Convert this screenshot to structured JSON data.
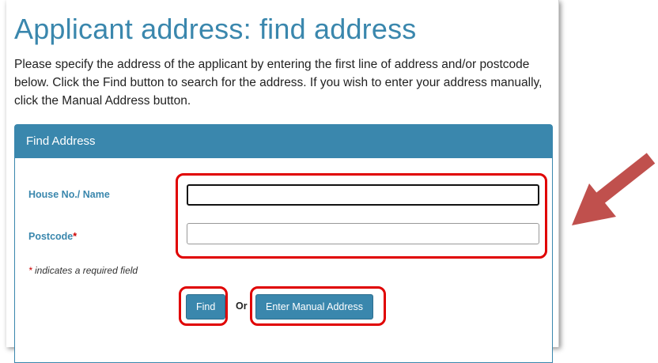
{
  "page": {
    "title": "Applicant address: find address",
    "intro": "Please specify the address of the applicant by entering the first line of address and/or postcode below. Click the Find button to search for the address. If you wish to enter your address manually, click the Manual Address button."
  },
  "panel": {
    "heading": "Find Address",
    "house_label": "House No./ Name",
    "house_value": "",
    "postcode_label": "Postcode",
    "postcode_value": "",
    "required_star": "*",
    "required_note": "indicates a required field",
    "find_label": "Find",
    "or_label": "Or",
    "manual_label": "Enter Manual Address"
  },
  "colors": {
    "accent": "#3a87ad",
    "highlight": "#e00000",
    "arrow": "#c0504d"
  },
  "annotations": {
    "arrow_icon": "arrow-pointer-icon"
  }
}
